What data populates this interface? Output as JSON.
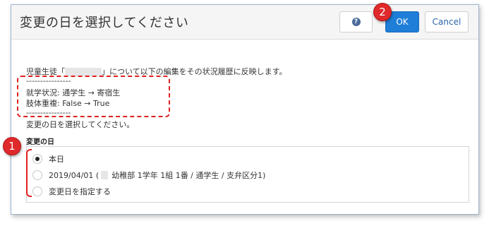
{
  "dialog": {
    "title": "変更の日を選択してください",
    "help_icon": "question-icon",
    "ok_label": "OK",
    "cancel_label": "Cancel"
  },
  "message": {
    "line1_prefix": "児童生徒「",
    "line1_suffix": "」について以下の編集をその状況履歴に反映します。",
    "separator": "----------------",
    "change1": "就学状況: 通学生 → 寄宿生",
    "change2": "肢体重複: False → True",
    "prompt": "変更の日を選択してください。"
  },
  "section_label": "変更の日",
  "options": [
    {
      "label": "本日",
      "checked": true
    },
    {
      "label_prefix": "2019/04/01 (",
      "label_suffix": "幼稚部 1学年 1組 1番 / 通学生 / 支弁区分1)",
      "checked": false
    },
    {
      "label": "変更日を指定する",
      "checked": false
    }
  ],
  "annotations": {
    "badge1": "1",
    "badge2": "2",
    "accent_color": "#e0292a"
  },
  "colors": {
    "ok_button": "#1e7ed8",
    "cancel_text": "#2b64a8"
  }
}
